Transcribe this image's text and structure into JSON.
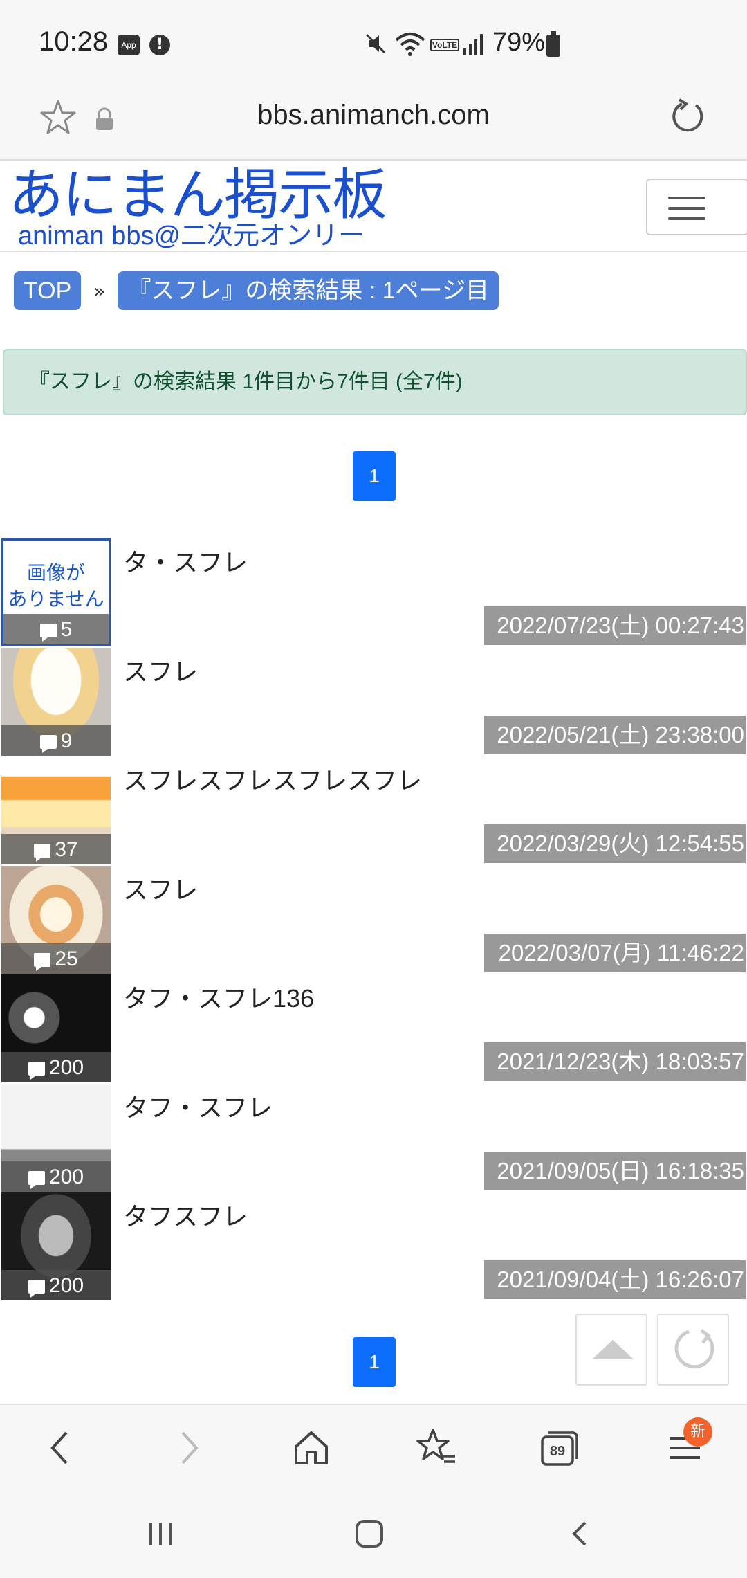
{
  "status": {
    "time": "10:28",
    "app_badge": "App",
    "battery_pct": "79%",
    "volte": "VoLTE"
  },
  "browser": {
    "url": "bbs.animanch.com",
    "tabs_count": "89",
    "menu_badge": "新"
  },
  "site": {
    "logo_main": "あにまん掲示板",
    "logo_sub": "animan bbs@二次元オンリー"
  },
  "breadcrumb": {
    "top": "TOP",
    "separator": "»",
    "current": "『スフレ』の検索結果 : 1ページ目"
  },
  "result_alert": "『スフレ』の検索結果 1件目から7件目 (全7件)",
  "pagination": {
    "current_page": "1"
  },
  "no_image": {
    "line1": "画像が",
    "line2": "ありません"
  },
  "threads": [
    {
      "title": "タ・スフレ",
      "count": "5",
      "date": "2022/07/23(土) 00:27:43"
    },
    {
      "title": "スフレ",
      "count": "9",
      "date": "2022/05/21(土) 23:38:00"
    },
    {
      "title": "スフレスフレスフレスフレ",
      "count": "37",
      "date": "2022/03/29(火) 12:54:55"
    },
    {
      "title": "スフレ",
      "count": "25",
      "date": "2022/03/07(月) 11:46:22"
    },
    {
      "title": "タフ・スフレ136",
      "count": "200",
      "date": "2021/12/23(木) 18:03:57"
    },
    {
      "title": "タフ・スフレ",
      "count": "200",
      "date": "2021/09/05(日) 16:18:35"
    },
    {
      "title": "タフスフレ",
      "count": "200",
      "date": "2021/09/04(土) 16:26:07"
    }
  ]
}
